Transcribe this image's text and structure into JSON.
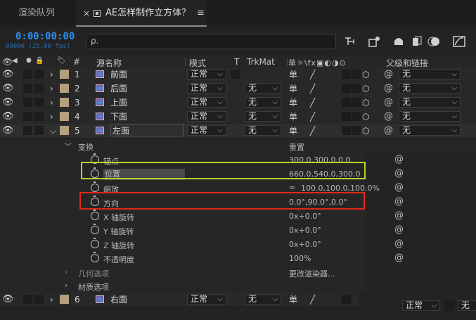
{
  "tabs": [
    {
      "label": "渲染队列"
    },
    {
      "label": "AE怎样制作立方体？",
      "close": "×",
      "menu": "≡"
    }
  ],
  "timeline": {
    "timecode": "0:00:00:00",
    "fps": "00000 (25.00 fps)",
    "search_placeholder": "ρ."
  },
  "columns": {
    "hash": "#",
    "source_name": "源名称",
    "mode": "模式",
    "t": "T",
    "trkmat": "TrkMat",
    "parent": "父级和链接"
  },
  "layers": [
    {
      "num": "1",
      "name": "前面",
      "mode": "正常",
      "trkmat": "",
      "parent": "无"
    },
    {
      "num": "2",
      "name": "后面",
      "mode": "正常",
      "trkmat": "无",
      "parent": "无"
    },
    {
      "num": "3",
      "name": "上面",
      "mode": "正常",
      "trkmat": "无",
      "parent": "无"
    },
    {
      "num": "4",
      "name": "下面",
      "mode": "正常",
      "trkmat": "无",
      "parent": "无"
    },
    {
      "num": "5",
      "name": "左面",
      "mode": "正常",
      "trkmat": "无",
      "parent": "无"
    }
  ],
  "transform": {
    "group": "变换",
    "reset": "重置",
    "props": [
      {
        "name": "锚点",
        "value": "300.0,300.0,0.0"
      },
      {
        "name": "位置",
        "value": "660.0,540.0,300.0"
      },
      {
        "name": "缩放",
        "value": "100.0,100.0,100.0%"
      },
      {
        "name": "方向",
        "value": "0.0°,90.0°,0.0°"
      },
      {
        "name": "X 轴旋转",
        "value": "0x+0.0°"
      },
      {
        "name": "Y 轴旋转",
        "value": "0x+0.0°"
      },
      {
        "name": "Z 轴旋转",
        "value": "0x+0.0°"
      },
      {
        "name": "不透明度",
        "value": "100%"
      }
    ]
  },
  "geometry": {
    "label": "几何选项",
    "value": "更改渲染器..."
  },
  "material": {
    "label": "材质选项"
  },
  "layer6": {
    "num": "6",
    "name": "右面",
    "mode": "正常",
    "trkmat": "无"
  },
  "bottom": {
    "mode": "正常",
    "parent": "无"
  },
  "colors": {
    "accent": "#2d8ceb",
    "green_highlight": "#b5d42a",
    "red_highlight": "#e0281a"
  }
}
